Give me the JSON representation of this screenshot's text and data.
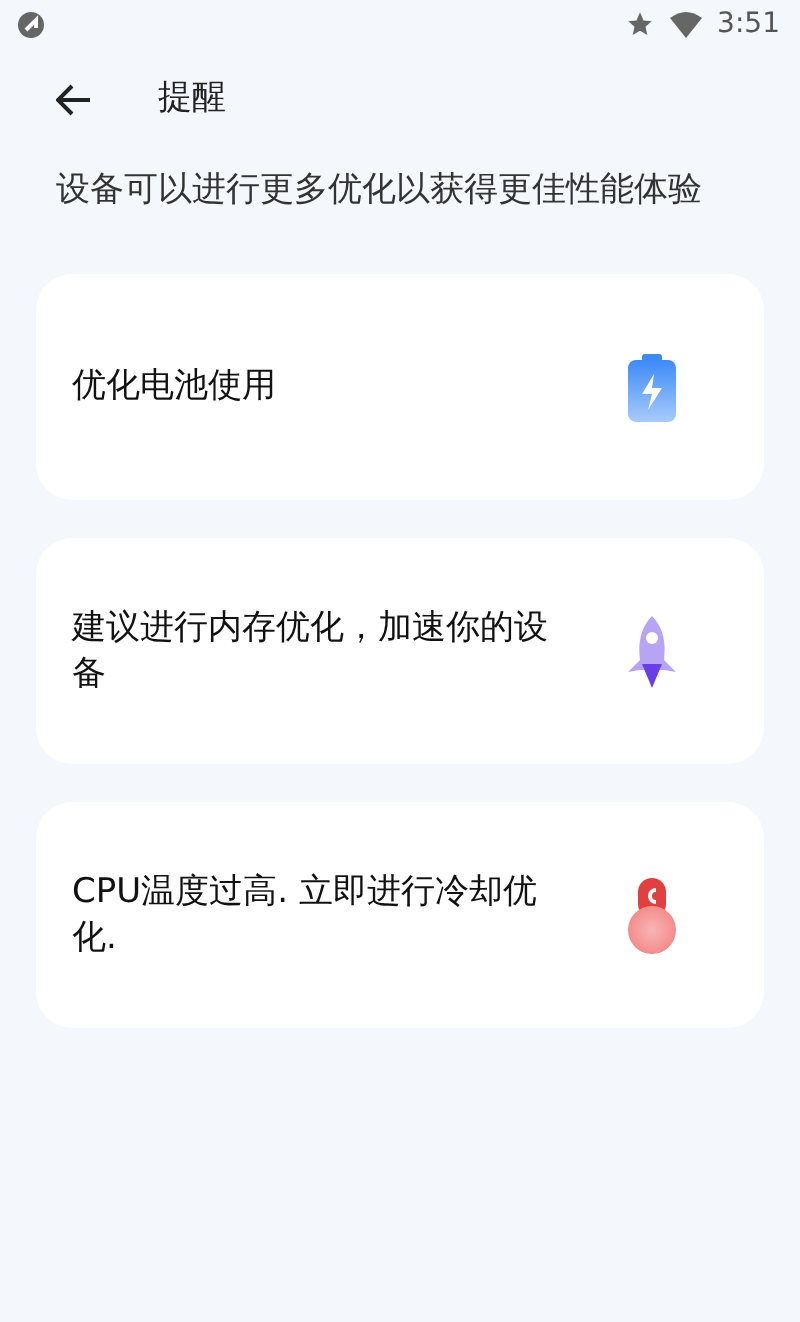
{
  "status_bar": {
    "time": "3:51"
  },
  "header": {
    "title": "提醒"
  },
  "subtitle": "设备可以进行更多优化以获得更佳性能体验",
  "cards": [
    {
      "text": "优化电池使用",
      "kind": "battery"
    },
    {
      "text": "建议进行内存优化，加速你的设备",
      "kind": "rocket"
    },
    {
      "text": "CPU温度过高. 立即进行冷却优化.",
      "kind": "thermometer"
    }
  ]
}
